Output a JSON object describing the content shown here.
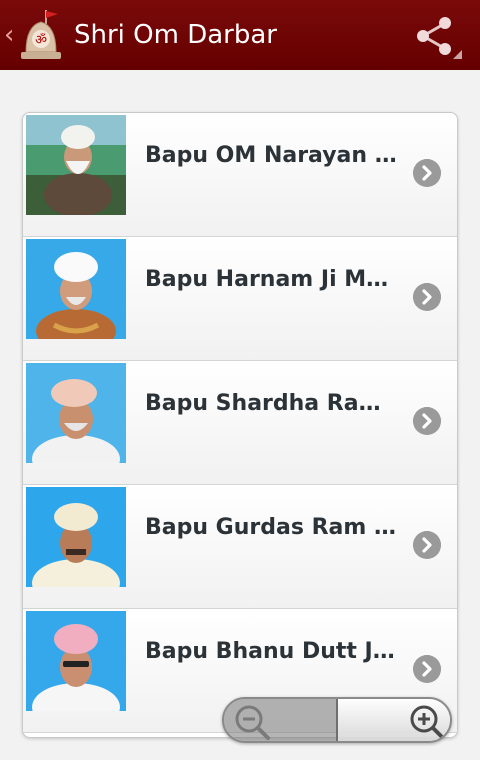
{
  "actionbar": {
    "title": "Shri Om Darbar",
    "up_icon": "chevron-left-icon",
    "logo_icon": "temple-om-icon",
    "share_icon": "share-icon",
    "bar_color": "#6b0000"
  },
  "list": {
    "items": [
      {
        "title": "Bapu OM Narayan Du…",
        "photo": "portrait-white-turban-icon",
        "chevron_icon": "chevron-right-circle-icon"
      },
      {
        "title": "Bapu Harnam Ji Mah…",
        "photo": "portrait-white-turban-icon",
        "chevron_icon": "chevron-right-circle-icon"
      },
      {
        "title": "Bapu Shardha Ram Ji…",
        "photo": "portrait-pink-turban-icon",
        "chevron_icon": "chevron-right-circle-icon"
      },
      {
        "title": "Bapu Gurdas Ram Ji …",
        "photo": "portrait-cream-turban-icon",
        "chevron_icon": "chevron-right-circle-icon"
      },
      {
        "title": "Bapu Bhanu Dutt Ji M…",
        "photo": "portrait-pink-turban-icon",
        "chevron_icon": "chevron-right-circle-icon"
      }
    ]
  },
  "zoom": {
    "out_icon": "zoom-out-icon",
    "in_icon": "zoom-in-icon"
  }
}
